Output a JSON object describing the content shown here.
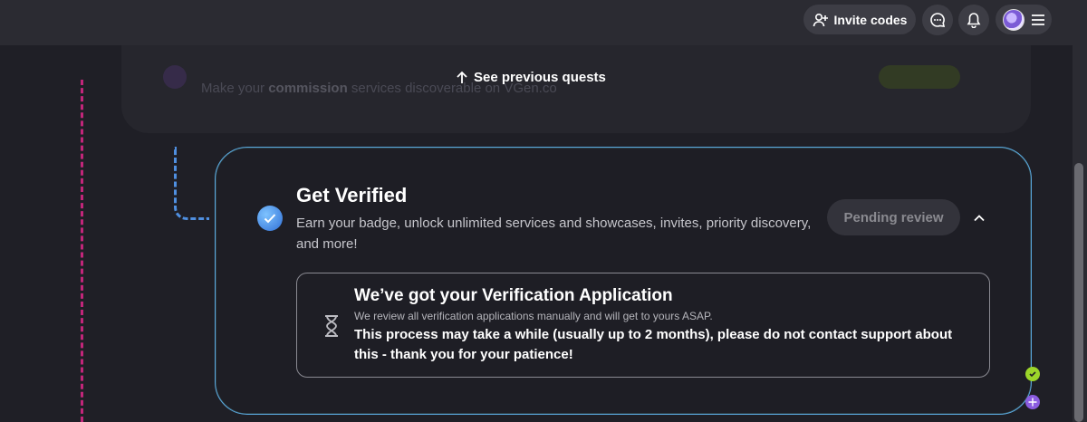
{
  "topbar": {
    "invite_label": "Invite codes",
    "icons": [
      "add-user-icon",
      "chat-icon",
      "bell-icon",
      "avatar",
      "menu-icon"
    ]
  },
  "previous_quest": {
    "see_previous_label": "See previous quests",
    "desc_prefix": "Make your ",
    "desc_bold": "commission",
    "desc_suffix": " services discoverable on VGen.co"
  },
  "quest": {
    "title": "Get Verified",
    "description": "Earn your badge, unlock unlimited services and showcases, invites, priority discovery, and more!",
    "status_button": "Pending review"
  },
  "status_box": {
    "title": "We’ve got your Verification Application",
    "subtitle": "We review all verification applications manually and will get to yours ASAP.",
    "note": "This process may take a while (usually up to 2 months), please do not contact support about this - thank you for your patience!"
  },
  "colors": {
    "background": "#1f1f26",
    "topbar": "#2b2b32",
    "accent_blue": "#4f8fe0",
    "accent_pink": "#c2267a",
    "card_border": "#5aa9e0"
  }
}
